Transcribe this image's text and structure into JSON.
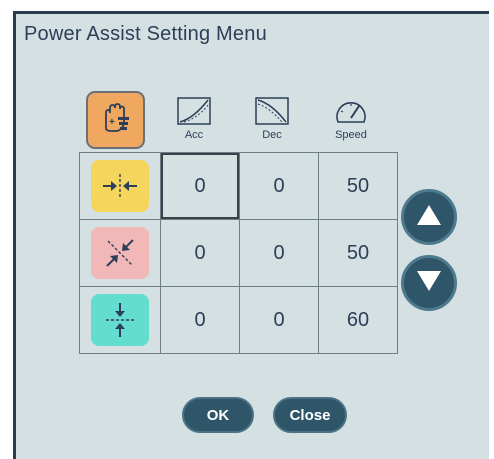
{
  "window": {
    "title": "Power Assist Setting Menu"
  },
  "columns": [
    {
      "label": "Acc",
      "icon": "acceleration-curve-icon"
    },
    {
      "label": "Dec",
      "icon": "deceleration-curve-icon"
    },
    {
      "label": "Speed",
      "icon": "speedometer-icon"
    }
  ],
  "header_icon": "hand-assist-icon",
  "rows": [
    {
      "icon": "compress-horizontal-icon",
      "color": "#f6d55c",
      "acc": "0",
      "dec": "0",
      "speed": "50"
    },
    {
      "icon": "compress-diagonal-icon",
      "color": "#f2b7b7",
      "acc": "0",
      "dec": "0",
      "speed": "50"
    },
    {
      "icon": "compress-vertical-icon",
      "color": "#63ddd0",
      "acc": "0",
      "dec": "0",
      "speed": "60"
    }
  ],
  "buttons": {
    "ok": "OK",
    "close": "Close"
  },
  "colors": {
    "panel": "#d4e0e2",
    "button": "#2e5568",
    "accent": "#f0a860"
  }
}
